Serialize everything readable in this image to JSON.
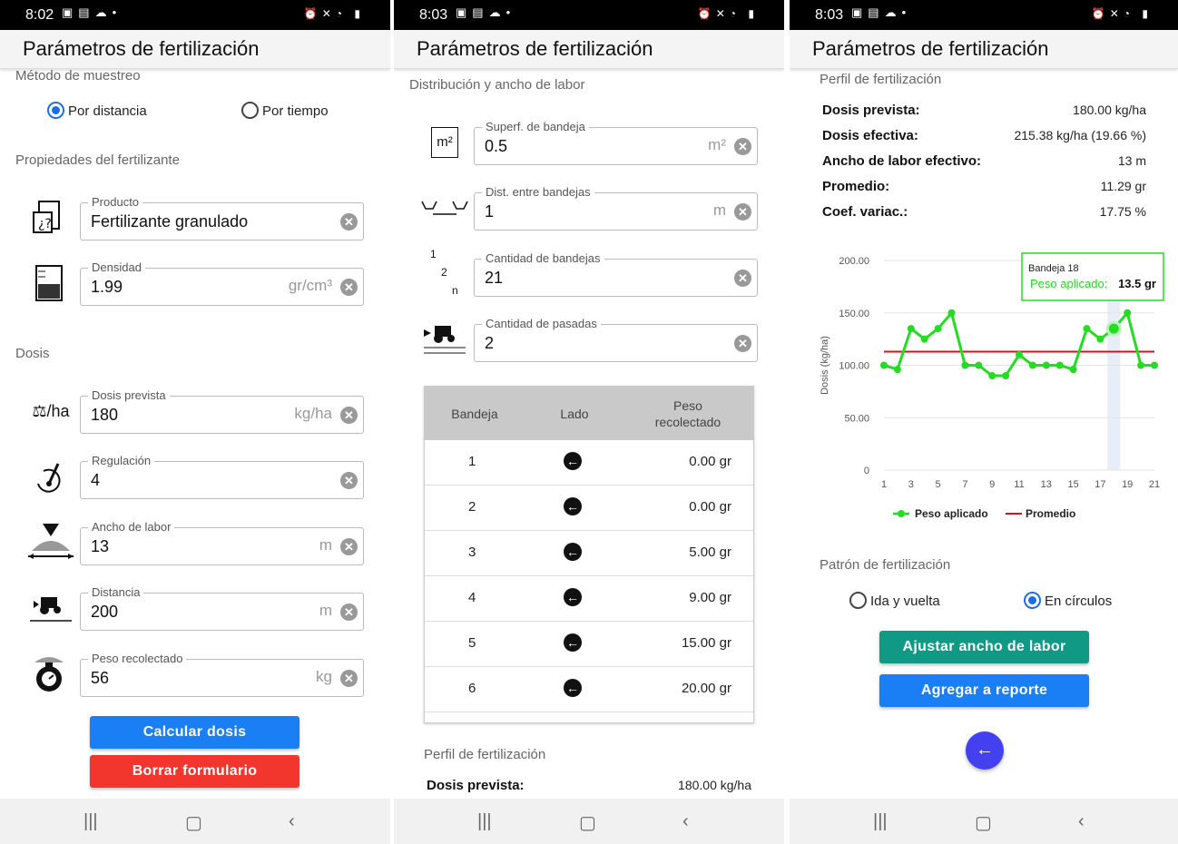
{
  "screens": [
    {
      "status_time": "8:02",
      "title": "Parámetros de fertilización",
      "sampling": {
        "heading": "Método de muestreo",
        "options": [
          "Por distancia",
          "Por tiempo"
        ],
        "selected": "Por distancia"
      },
      "properties_heading": "Propiedades del fertilizante",
      "product": {
        "label": "Producto",
        "value": "Fertilizante granulado"
      },
      "density": {
        "label": "Densidad",
        "value": "1.99",
        "unit": "gr/cm³"
      },
      "dose_heading": "Dosis",
      "dose": {
        "label": "Dosis prevista",
        "value": "180",
        "unit": "kg/ha",
        "icon_text": "/ha"
      },
      "regulation": {
        "label": "Regulación",
        "value": "4"
      },
      "width": {
        "label": "Ancho de labor",
        "value": "13",
        "unit": "m"
      },
      "distance": {
        "label": "Distancia",
        "value": "200",
        "unit": "m"
      },
      "weight": {
        "label": "Peso recolectado",
        "value": "56",
        "unit": "kg"
      },
      "calc_button": "Calcular dosis",
      "clear_button": "Borrar formulario"
    },
    {
      "status_time": "8:03",
      "title": "Parámetros de fertilización",
      "heading": "Distribución y ancho de labor",
      "tray_area": {
        "label": "Superf. de bandeja",
        "value": "0.5",
        "unit": "m²",
        "icon_text": "m²"
      },
      "tray_dist": {
        "label": "Dist. entre bandejas",
        "value": "1",
        "unit": "m"
      },
      "tray_count": {
        "label": "Cantidad de bandejas",
        "value": "21",
        "icon_a": "1",
        "icon_b": "2",
        "icon_c": "n"
      },
      "passes": {
        "label": "Cantidad de pasadas",
        "value": "2"
      },
      "table": {
        "headers": [
          "Bandeja",
          "Lado",
          "Peso recolectado"
        ],
        "rows": [
          {
            "tray": "1",
            "weight": "0.00 gr"
          },
          {
            "tray": "2",
            "weight": "0.00 gr"
          },
          {
            "tray": "3",
            "weight": "5.00 gr"
          },
          {
            "tray": "4",
            "weight": "9.00 gr"
          },
          {
            "tray": "5",
            "weight": "15.00 gr"
          },
          {
            "tray": "6",
            "weight": "20.00 gr"
          }
        ]
      },
      "profile_heading": "Perfil de fertilización",
      "planned_label": "Dosis prevista:",
      "planned_value": "180.00 kg/ha"
    },
    {
      "status_time": "8:03",
      "title": "Parámetros de fertilización",
      "profile_heading": "Perfil de fertilización",
      "summary": [
        {
          "k": "Dosis prevista:",
          "v": "180.00 kg/ha"
        },
        {
          "k": "Dosis efectiva:",
          "v": "215.38 kg/ha (19.66 %)"
        },
        {
          "k": "Ancho de labor efectivo:",
          "v": "13 m"
        },
        {
          "k": "Promedio:",
          "v": "11.29 gr"
        },
        {
          "k": "Coef. variac.:",
          "v": "17.75 %"
        }
      ],
      "pattern": {
        "heading": "Patrón de fertilización",
        "options": [
          "Ida y vuelta",
          "En círculos"
        ],
        "selected": "En círculos"
      },
      "adjust_button": "Ajustar ancho de labor",
      "report_button": "Agregar a reporte",
      "back_icon": "arrow-left-icon"
    }
  ],
  "chart_data": {
    "type": "line",
    "title": "",
    "xlabel": "",
    "ylabel": "Dosis (kg/ha)",
    "ylim": [
      0,
      200
    ],
    "yticks": [
      "0",
      "50.00",
      "100.00",
      "150.00",
      "200.00"
    ],
    "xticks": [
      "1",
      "3",
      "5",
      "7",
      "9",
      "11",
      "13",
      "15",
      "17",
      "19",
      "21"
    ],
    "x": [
      1,
      2,
      3,
      4,
      5,
      6,
      7,
      8,
      9,
      10,
      11,
      12,
      13,
      14,
      15,
      16,
      17,
      18,
      19,
      20,
      21
    ],
    "series": [
      {
        "name": "Peso aplicado",
        "color": "#22dd22",
        "values": [
          100,
          96,
          135,
          125,
          135,
          150,
          100,
          100,
          90,
          90,
          110,
          100,
          100,
          100,
          96,
          135,
          125,
          135,
          150,
          100,
          100
        ]
      },
      {
        "name": "Promedio",
        "color": "#d0161b",
        "values": [
          113,
          113
        ]
      }
    ],
    "tooltip": {
      "title": "Bandeja 18",
      "label": "Peso aplicado:",
      "value": "13.5 gr"
    },
    "highlight_x": 18,
    "grid": true,
    "legend": "bottom"
  }
}
